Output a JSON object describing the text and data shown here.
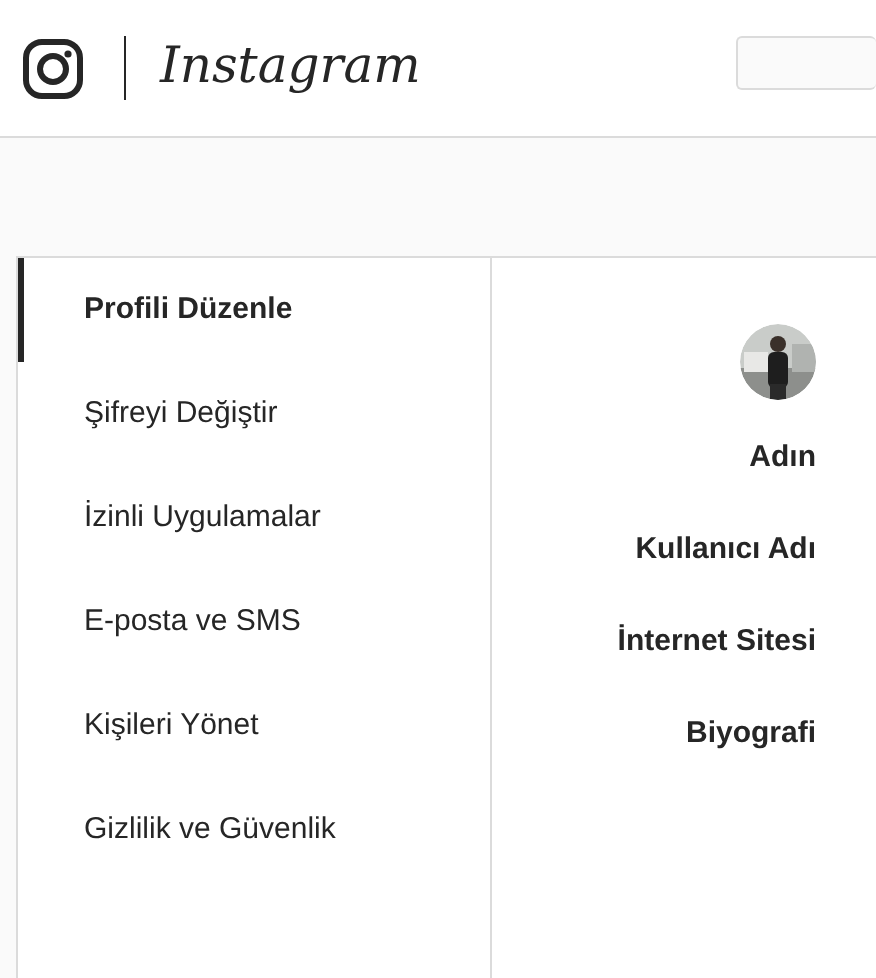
{
  "header": {
    "logo_text": "Instagram"
  },
  "sidebar": {
    "items": [
      {
        "label": "Profili Düzenle",
        "selected": true
      },
      {
        "label": "Şifreyi Değiştir",
        "selected": false
      },
      {
        "label": "İzinli Uygulamalar",
        "selected": false
      },
      {
        "label": "E-posta ve SMS",
        "selected": false
      },
      {
        "label": "Kişileri Yönet",
        "selected": false
      },
      {
        "label": "Gizlilik ve Güvenlik",
        "selected": false
      }
    ]
  },
  "form": {
    "fields": [
      {
        "label": "Adın"
      },
      {
        "label": "Kullanıcı Adı"
      },
      {
        "label": "İnternet Sitesi"
      },
      {
        "label": "Biyografi"
      }
    ]
  }
}
